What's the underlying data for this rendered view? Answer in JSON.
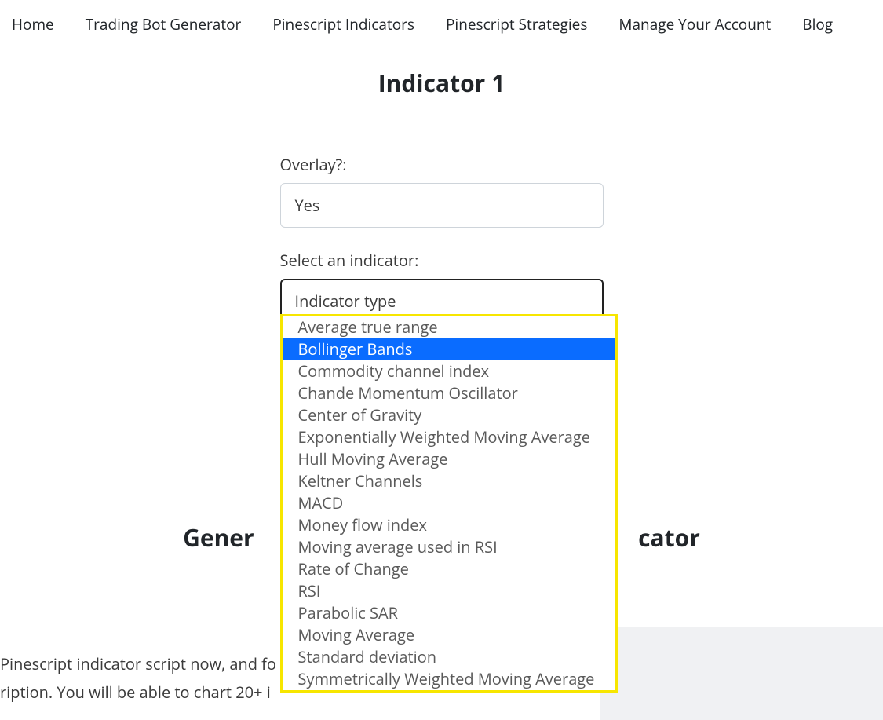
{
  "nav": {
    "items": [
      "Home",
      "Trading Bot Generator",
      "Pinescript Indicators",
      "Pinescript Strategies",
      "Manage Your Account",
      "Blog"
    ]
  },
  "page_title": "Indicator 1",
  "overlay": {
    "label": "Overlay?:",
    "value": "Yes"
  },
  "indicator_select": {
    "label": "Select an indicator:",
    "placeholder": "Indicator type",
    "highlighted_index": 1,
    "options": [
      "Average true range",
      "Bollinger Bands",
      "Commodity channel index",
      "Chande Momentum Oscillator",
      "Center of Gravity",
      "Exponentially Weighted Moving Average",
      "Hull Moving Average",
      "Keltner Channels",
      "MACD",
      "Money flow index",
      "Moving average used in RSI",
      "Rate of Change",
      "RSI",
      "Parabolic SAR",
      "Moving Average",
      "Standard deviation",
      "Symmetrically Weighted Moving Average"
    ]
  },
  "section_heading_parts": {
    "left": "Gener",
    "right": "cator"
  },
  "bottom_text_lines": [
    "Pinescript indicator script now, and fo",
    "ription. You will be able to chart 20+ i"
  ]
}
